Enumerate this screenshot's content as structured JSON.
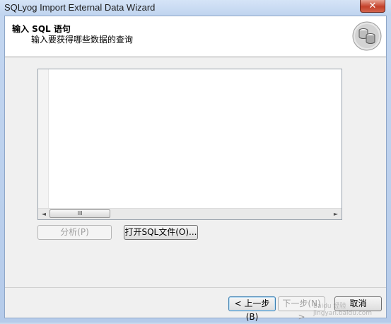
{
  "window": {
    "title": "SQLyog Import External Data Wizard",
    "close_glyph": "✕"
  },
  "header": {
    "title": "输入 SQL 语句",
    "subtitle": "输入要获得哪些数据的查询",
    "icon": "database-icon"
  },
  "editor": {
    "content": "",
    "scroll_thumb": "III",
    "left_arrow": "◄",
    "right_arrow": "►"
  },
  "buttons": {
    "analyze": "分析(P)",
    "open_sql_file": "打开SQL文件(O)...",
    "back": "< 上一步(B)",
    "next": "下一步(N) >",
    "cancel": "取消"
  },
  "watermark": "Baidu 经验 jingyan.baidu.com"
}
